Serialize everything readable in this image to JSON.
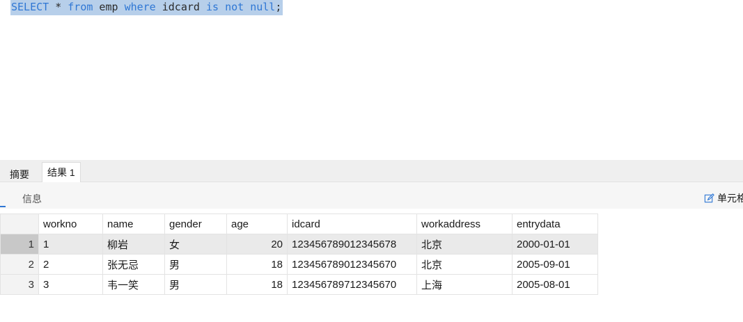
{
  "editor": {
    "sql_tokens": [
      {
        "text": "SELECT",
        "kind": "kw"
      },
      {
        "text": " * ",
        "kind": "tx"
      },
      {
        "text": "from",
        "kind": "kw"
      },
      {
        "text": " emp ",
        "kind": "tx"
      },
      {
        "text": "where",
        "kind": "kw"
      },
      {
        "text": " idcard ",
        "kind": "tx"
      },
      {
        "text": "is",
        "kind": "kw"
      },
      {
        "text": " ",
        "kind": "tx"
      },
      {
        "text": "not",
        "kind": "kw"
      },
      {
        "text": " ",
        "kind": "tx"
      },
      {
        "text": "null",
        "kind": "kw"
      },
      {
        "text": ";",
        "kind": "tx"
      }
    ]
  },
  "result_tabs": {
    "summary": "摘要",
    "result1": "结果 1"
  },
  "subtabs": {
    "first_fragment": "",
    "info": "信息",
    "cell_editor": "单元格"
  },
  "grid": {
    "columns": [
      "workno",
      "name",
      "gender",
      "age",
      "idcard",
      "workaddress",
      "entrydata"
    ],
    "rows": [
      {
        "index": "1",
        "cells": [
          "1",
          "柳岩",
          "女",
          "20",
          "123456789012345678",
          "北京",
          "2000-01-01"
        ],
        "selected": true
      },
      {
        "index": "2",
        "cells": [
          "2",
          "张无忌",
          "男",
          "18",
          "123456789012345670",
          "北京",
          "2005-09-01"
        ],
        "selected": false
      },
      {
        "index": "3",
        "cells": [
          "3",
          "韦一笑",
          "男",
          "18",
          "123456789712345670",
          "上海",
          "2005-08-01"
        ],
        "selected": false
      }
    ]
  },
  "colors": {
    "keyword": "#2f77d4",
    "selection": "#b7cfea",
    "accent": "#2f77d4"
  },
  "icons": {
    "cell_editor": "edit-pencil-icon"
  }
}
